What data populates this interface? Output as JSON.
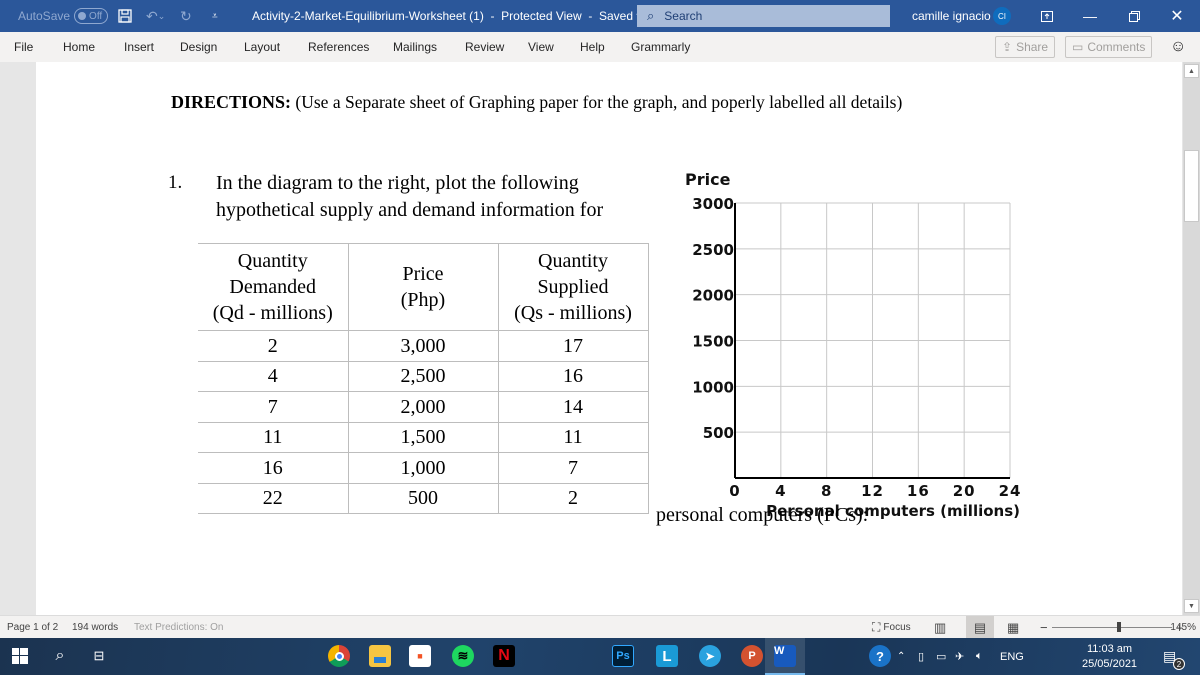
{
  "titlebar": {
    "autosave_label": "AutoSave",
    "autosave_state": "Off",
    "document_title": "Activity-2-Market-Equilibrium-Worksheet (1)  -  Protected View  -  Saved ▾",
    "search_placeholder": "Search",
    "user_name": "camille ignacio",
    "user_initials": "CI",
    "icons": [
      "save-icon",
      "undo-icon",
      "redo-icon",
      "customize-quick-access-icon",
      "ribbon-display-options-icon",
      "minimize-icon",
      "restore-icon",
      "close-icon"
    ]
  },
  "menubar": {
    "items": [
      "File",
      "Home",
      "Insert",
      "Design",
      "Layout",
      "References",
      "Mailings",
      "Review",
      "View",
      "Help",
      "Grammarly"
    ],
    "share_label": "Share",
    "comments_label": "Comments"
  },
  "document": {
    "directions_bold": "DIRECTIONS:",
    "directions_text": " (Use a Separate sheet of Graphing paper for the graph, and poperly labelled all details)",
    "question_number": "1.",
    "question_line1": "In the diagram to the right, plot the following",
    "question_line2": "hypothetical supply and demand information for",
    "question_continuation": "personal computers (PCs):",
    "table": {
      "headers": [
        [
          "Quantity",
          "Demanded",
          "(Qd - millions)"
        ],
        [
          "Price",
          "(Php)"
        ],
        [
          "Quantity",
          "Supplied",
          "(Qs - millions)"
        ]
      ],
      "rows": [
        [
          "2",
          "3,000",
          "17"
        ],
        [
          "4",
          "2,500",
          "16"
        ],
        [
          "7",
          "2,000",
          "14"
        ],
        [
          "11",
          "1,500",
          "11"
        ],
        [
          "16",
          "1,000",
          "7"
        ],
        [
          "22",
          "500",
          "2"
        ]
      ]
    }
  },
  "chart_data": {
    "type": "line",
    "title": "",
    "ylabel": "Price",
    "xlabel": "Personal computers (millions)",
    "xlim": [
      0,
      24
    ],
    "ylim": [
      0,
      3000
    ],
    "x_ticks": [
      "0",
      "4",
      "8",
      "12",
      "16",
      "20",
      "24"
    ],
    "y_ticks": [
      "500",
      "1000",
      "1500",
      "2000",
      "2500",
      "3000"
    ],
    "grid": true,
    "series": []
  },
  "statusbar": {
    "page": "Page 1 of 2",
    "words": "194 words",
    "predictions": "Text Predictions: On",
    "focus_label": "Focus",
    "zoom_level": "145%",
    "zoom_fraction": 0.56
  },
  "taskbar": {
    "apps": [
      "Chrome",
      "File Explorer",
      "Microsoft Store",
      "Spotify",
      "Netflix",
      "Photoshop",
      "Lens",
      "Telegram",
      "PowerPoint",
      "Word"
    ],
    "language": "ENG",
    "time": "11:03 am",
    "date": "25/05/2021",
    "notification_count": "2"
  }
}
